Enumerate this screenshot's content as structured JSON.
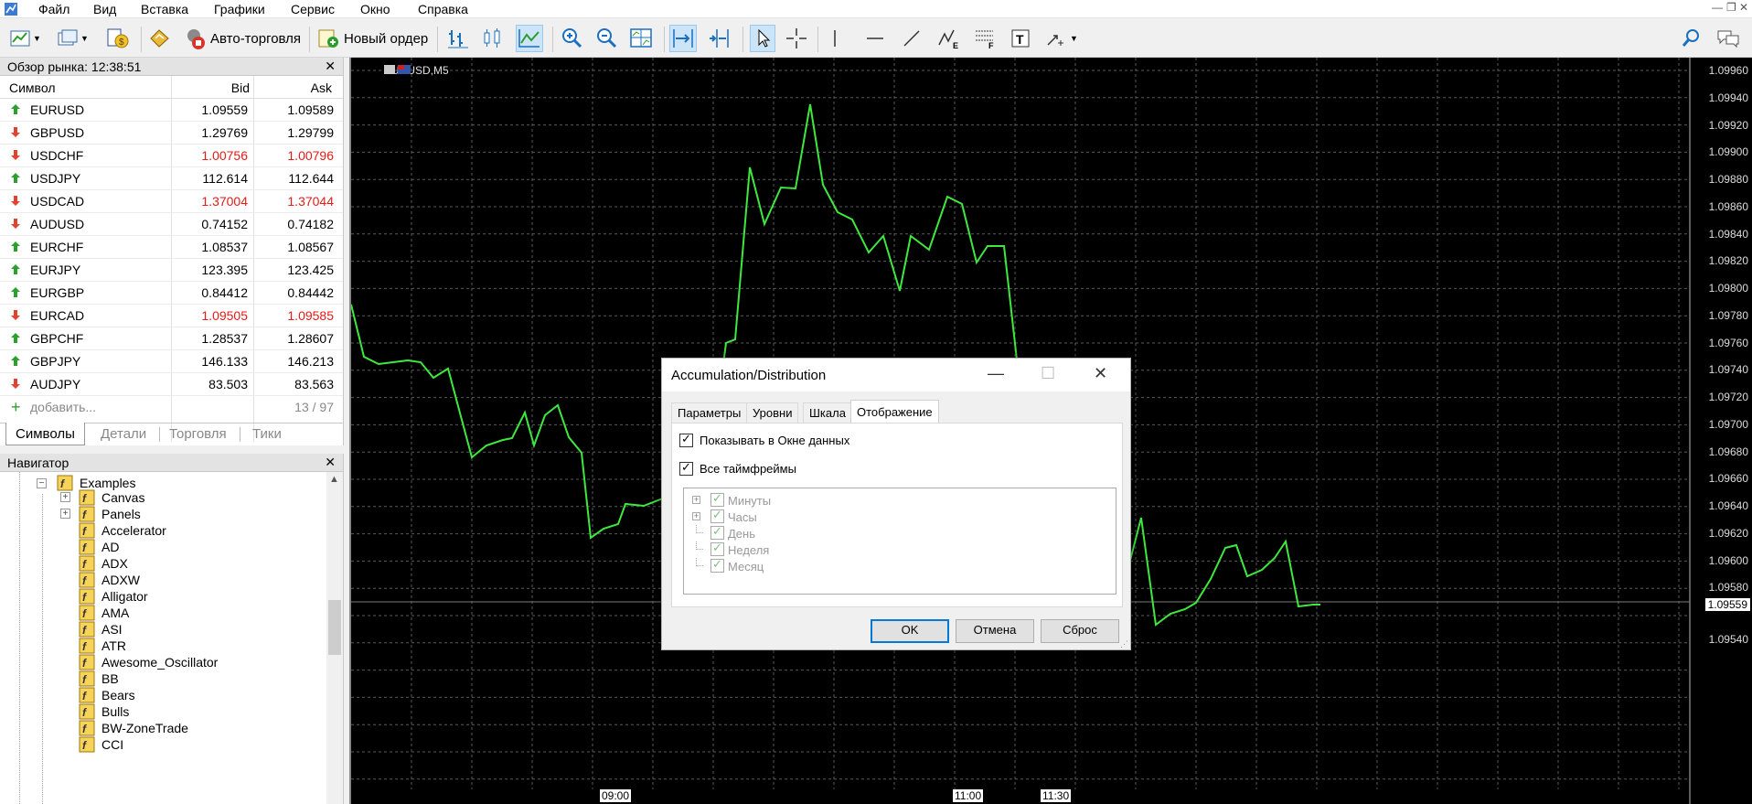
{
  "menu": {
    "items": [
      "Файл",
      "Вид",
      "Вставка",
      "Графики",
      "Сервис",
      "Окно",
      "Справка"
    ]
  },
  "toolbar": {
    "auto_trading_label": "Авто-торговля",
    "new_order_label": "Новый ордер"
  },
  "market_watch": {
    "title": "Обзор рынка: 12:38:51",
    "col_symbol": "Символ",
    "col_bid": "Bid",
    "col_ask": "Ask",
    "rows": [
      {
        "symbol": "EURUSD",
        "bid": "1.09559",
        "ask": "1.09589",
        "dir": "up"
      },
      {
        "symbol": "GBPUSD",
        "bid": "1.29769",
        "ask": "1.29799",
        "dir": "dn-black"
      },
      {
        "symbol": "USDCHF",
        "bid": "1.00756",
        "ask": "1.00796",
        "dir": "down"
      },
      {
        "symbol": "USDJPY",
        "bid": "112.614",
        "ask": "112.644",
        "dir": "up"
      },
      {
        "symbol": "USDCAD",
        "bid": "1.37004",
        "ask": "1.37044",
        "dir": "down"
      },
      {
        "symbol": "AUDUSD",
        "bid": "0.74152",
        "ask": "0.74182",
        "dir": "dn-black"
      },
      {
        "symbol": "EURCHF",
        "bid": "1.08537",
        "ask": "1.08567",
        "dir": "up"
      },
      {
        "symbol": "EURJPY",
        "bid": "123.395",
        "ask": "123.425",
        "dir": "up"
      },
      {
        "symbol": "EURGBP",
        "bid": "0.84412",
        "ask": "0.84442",
        "dir": "up"
      },
      {
        "symbol": "EURCAD",
        "bid": "1.09505",
        "ask": "1.09585",
        "dir": "down"
      },
      {
        "symbol": "GBPCHF",
        "bid": "1.28537",
        "ask": "1.28607",
        "dir": "up"
      },
      {
        "symbol": "GBPJPY",
        "bid": "146.133",
        "ask": "146.213",
        "dir": "up"
      },
      {
        "symbol": "AUDJPY",
        "bid": "83.503",
        "ask": "83.563",
        "dir": "dn-black"
      }
    ],
    "add_label": "добавить...",
    "count": "13 / 97",
    "tabs": [
      "Символы",
      "Детали",
      "Торговля",
      "Тики"
    ]
  },
  "navigator": {
    "title": "Навигатор",
    "folder": "Examples",
    "items": [
      "Canvas",
      "Panels",
      "Accelerator",
      "AD",
      "ADX",
      "ADXW",
      "Alligator",
      "AMA",
      "ASI",
      "ATR",
      "Awesome_Oscillator",
      "BB",
      "Bears",
      "Bulls",
      "BW-ZoneTrade",
      "CCI"
    ]
  },
  "chart": {
    "symbol_title": "EURUSD,M5",
    "price_labels": [
      "1.09960",
      "1.09940",
      "1.09920",
      "1.09900",
      "1.09880",
      "1.09860",
      "1.09840",
      "1.09820",
      "1.09800",
      "1.09780",
      "1.09760",
      "1.09740",
      "1.09720",
      "1.09700",
      "1.09680",
      "1.09660",
      "1.09640",
      "1.09620",
      "1.09600",
      "1.09580",
      "1.09559",
      "1.09540"
    ],
    "current_price": "1.09559",
    "time_labels": [
      "09:00",
      "11:00",
      "11:30"
    ],
    "line_color": "#3ee83e"
  },
  "dialog": {
    "title": "Accumulation/Distribution",
    "tabs": [
      "Параметры",
      "Уровни",
      "Шкала",
      "Отображение"
    ],
    "show_in_data_window": "Показывать в Окне данных",
    "all_timeframes": "Все таймфреймы",
    "timeframes": [
      "Минуты",
      "Часы",
      "День",
      "Неделя",
      "Месяц"
    ],
    "ok_label": "OK",
    "cancel_label": "Отмена",
    "reset_label": "Сброс"
  }
}
